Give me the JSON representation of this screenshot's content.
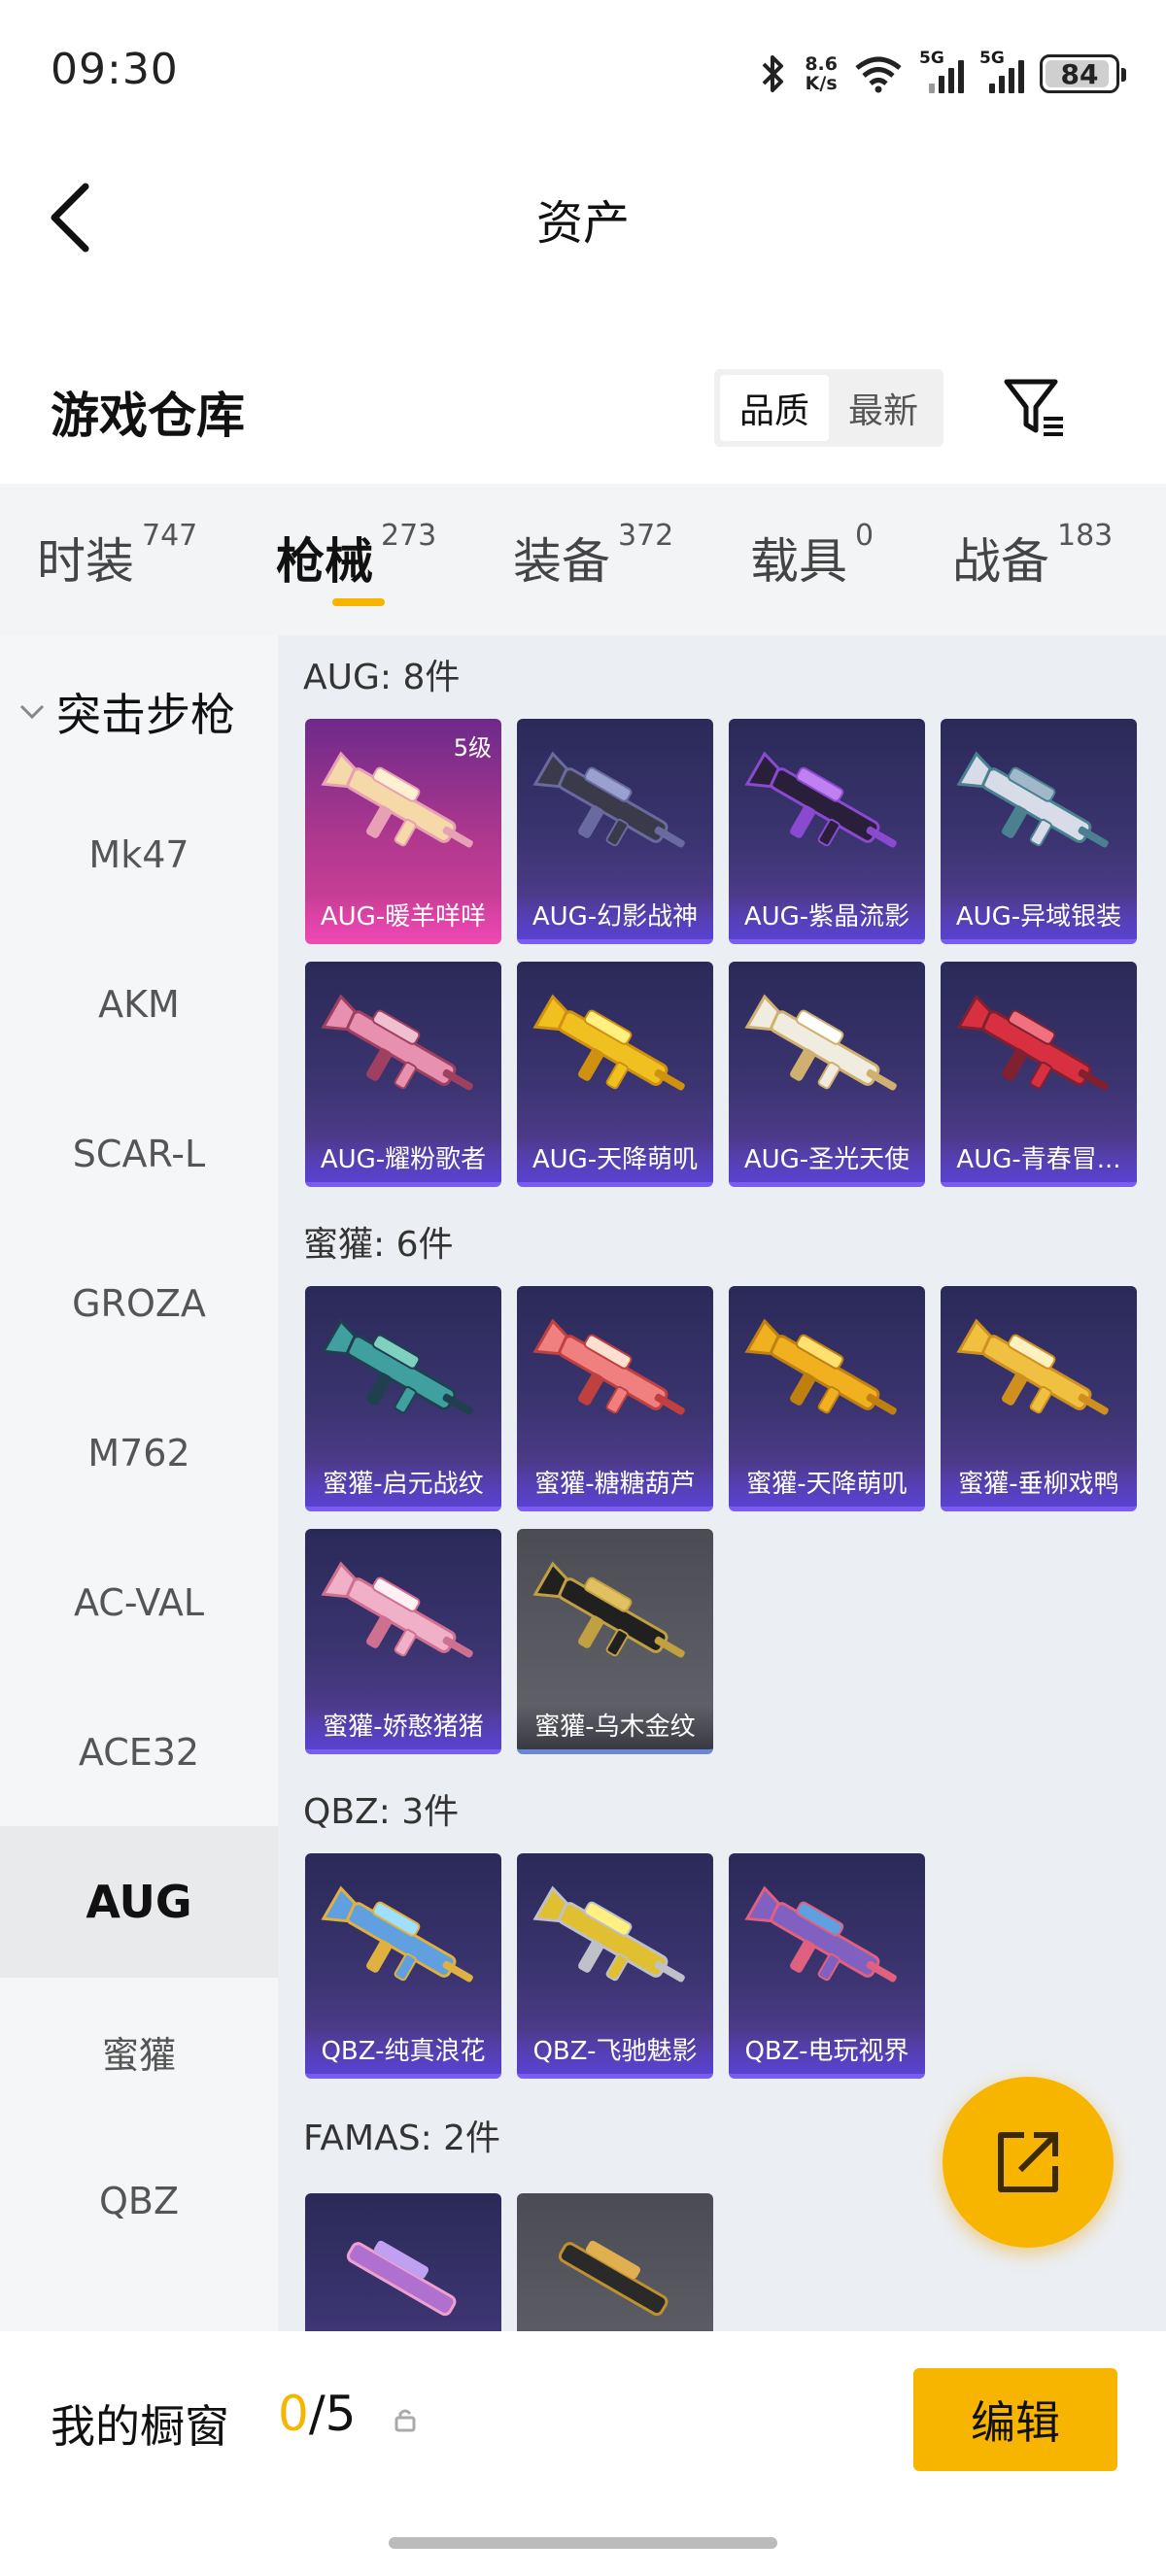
{
  "status": {
    "time": "09:30",
    "net_speed_value": "8.6",
    "net_speed_unit": "K/s",
    "sig1": "5G",
    "sig2": "5G",
    "battery": "84"
  },
  "header": {
    "title": "资产"
  },
  "warehouse": {
    "title": "游戏仓库",
    "sort_quality": "品质",
    "sort_latest": "最新"
  },
  "tabs": [
    {
      "label": "时装",
      "count": "747"
    },
    {
      "label": "枪械",
      "count": "273"
    },
    {
      "label": "装备",
      "count": "372"
    },
    {
      "label": "载具",
      "count": "0"
    },
    {
      "label": "战备",
      "count": "183"
    }
  ],
  "sidebar": {
    "category": "突击步枪",
    "items": [
      "Mk47",
      "AKM",
      "SCAR-L",
      "GROZA",
      "M762",
      "AC-VAL",
      "ACE32",
      "AUG",
      "蜜獾",
      "QBZ"
    ]
  },
  "groups": [
    {
      "title": "AUG: 8件",
      "items": [
        {
          "name": "AUG-暖羊咩咩",
          "level": "5级"
        },
        {
          "name": "AUG-幻影战神"
        },
        {
          "name": "AUG-紫晶流影"
        },
        {
          "name": "AUG-异域银装"
        },
        {
          "name": "AUG-耀粉歌者"
        },
        {
          "name": "AUG-天降萌叽"
        },
        {
          "name": "AUG-圣光天使"
        },
        {
          "name": "AUG-青春冒..."
        }
      ]
    },
    {
      "title": "蜜獾: 6件",
      "items": [
        {
          "name": "蜜獾-启元战纹"
        },
        {
          "name": "蜜獾-糖糖葫芦"
        },
        {
          "name": "蜜獾-天降萌叽"
        },
        {
          "name": "蜜獾-垂柳戏鸭"
        },
        {
          "name": "蜜獾-娇憨猪猪"
        },
        {
          "name": "蜜獾-乌木金纹"
        }
      ]
    },
    {
      "title": "QBZ: 3件",
      "items": [
        {
          "name": "QBZ-纯真浪花"
        },
        {
          "name": "QBZ-飞驰魅影"
        },
        {
          "name": "QBZ-电玩视界"
        }
      ]
    },
    {
      "title": "FAMAS: 2件",
      "items": []
    }
  ],
  "bottom": {
    "showcase_label": "我的橱窗",
    "showcase_current": "0",
    "showcase_total": "/5",
    "edit": "编辑"
  },
  "colors": {
    "accent": "#f7b500"
  }
}
